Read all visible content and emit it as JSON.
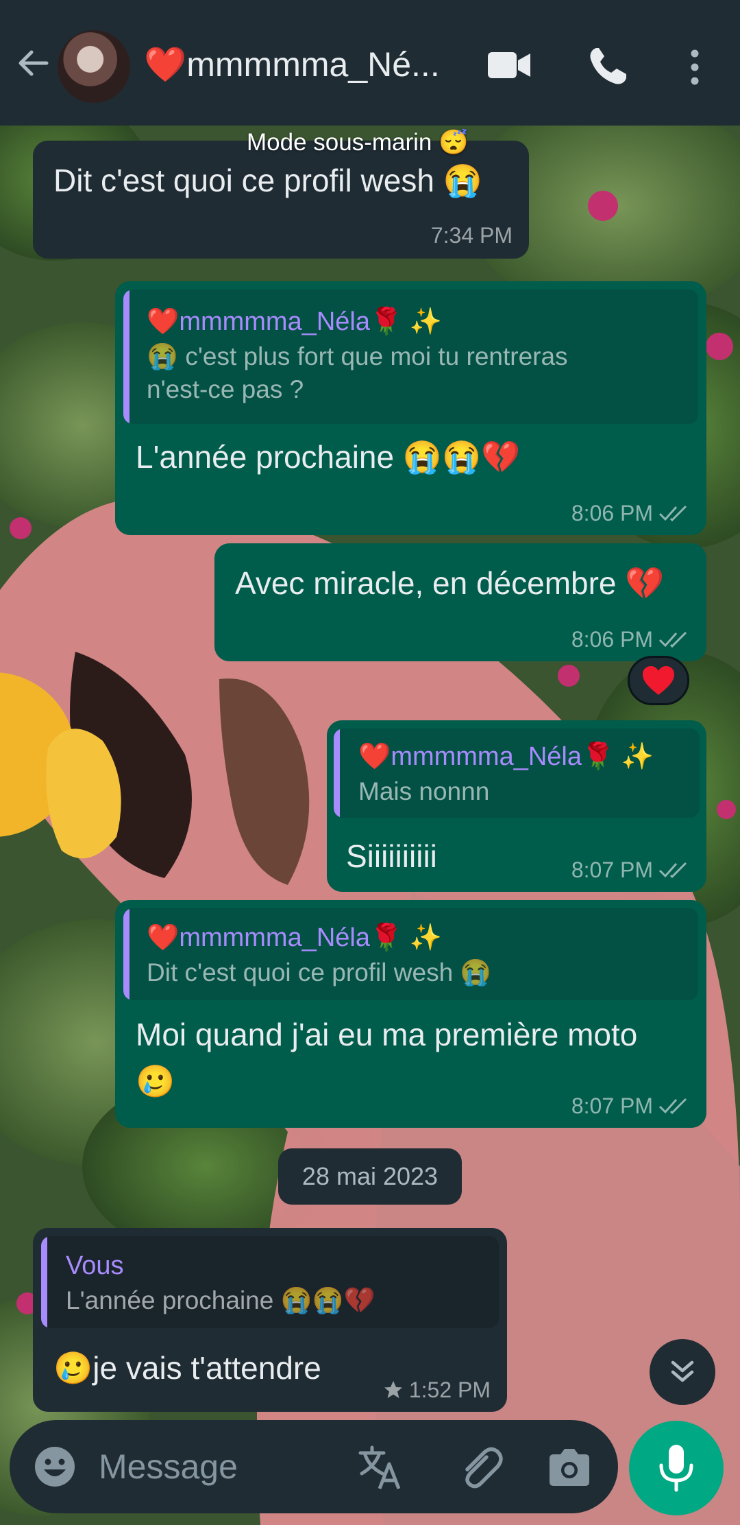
{
  "header": {
    "contact_name": "❤️mmmmma_Né...",
    "back_icon": "arrow-left-icon",
    "video_icon": "videocam-icon",
    "call_icon": "phone-icon",
    "menu_icon": "more-vert-icon"
  },
  "submarine_label": "Mode sous-marin 😴",
  "messages": [
    {
      "direction": "in",
      "text": "Dit c'est quoi ce profil wesh 😭",
      "time": "7:34 PM"
    },
    {
      "direction": "out",
      "quote_author": "❤️mmmmma_Néla🌹 ✨",
      "quote_text_1": "😭 c'est plus fort que moi tu rentreras",
      "quote_text_2": "n'est-ce pas ?",
      "text": "L'année prochaine 😭😭💔",
      "time": "8:06 PM"
    },
    {
      "direction": "out",
      "text": "Avec miracle, en décembre 💔",
      "time": "8:06 PM",
      "reaction": "❤️"
    },
    {
      "direction": "out",
      "quote_author": "❤️mmmmma_Néla🌹 ✨",
      "quote_text": "Mais nonnn",
      "text": "Siiiiiiiiii",
      "time": "8:07 PM"
    },
    {
      "direction": "out",
      "quote_author": "❤️mmmmma_Néla🌹 ✨",
      "quote_text": "Dit c'est quoi ce profil wesh 😭",
      "text_1": "Moi quand j'ai eu ma première moto",
      "text_2": "🥲",
      "time": "8:07 PM"
    },
    {
      "direction": "in",
      "quote_author": "Vous",
      "quote_text": "L'année prochaine 😭😭💔",
      "text": "🥲je vais t'attendre",
      "time": "1:52 PM",
      "starred": true
    }
  ],
  "date_separator": "28 mai 2023",
  "composer": {
    "placeholder": "Message",
    "emoji_icon": "emoji-icon",
    "translate_icon": "translate-icon",
    "attach_icon": "paperclip-icon",
    "camera_icon": "camera-icon",
    "mic_icon": "mic-icon"
  },
  "scroll_icon": "double-chevron-down-icon",
  "colors": {
    "header_bg": "#1f2c34",
    "incoming_bubble": "#1f2c34",
    "outgoing_bubble": "#005c4b",
    "quote_accent": "#a88bfd",
    "mic_button": "#00a884"
  }
}
